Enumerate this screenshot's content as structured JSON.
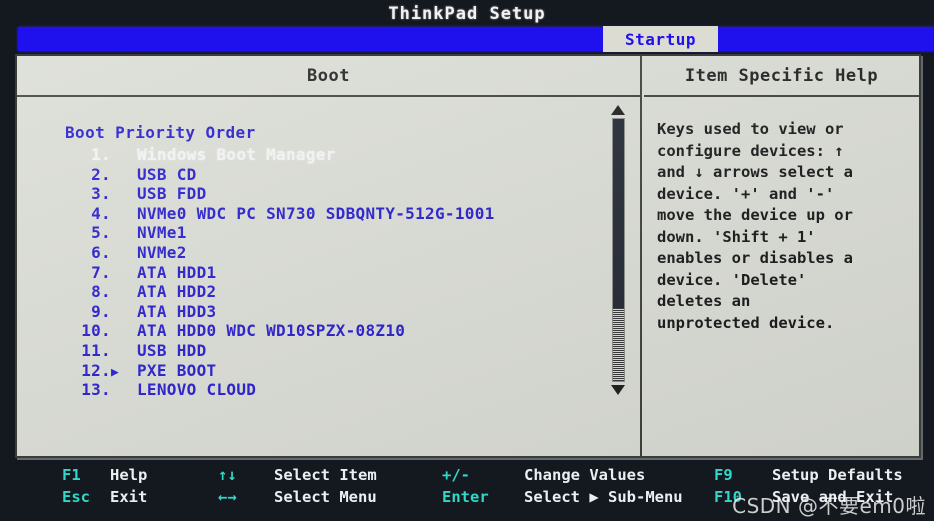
{
  "window": {
    "title": "ThinkPad Setup"
  },
  "menu": {
    "active_tab": "Startup",
    "bar_color": "#1f10ee",
    "tab_text_color": "#1f10ee",
    "tab_bg_color": "#dcdcd2"
  },
  "boot_pane": {
    "title": "Boot",
    "heading": "Boot Priority Order",
    "text_color": "#2217cc",
    "selected_text_color": "#f4f4f4",
    "items": [
      {
        "index": "1.",
        "arrow": "",
        "label": "Windows Boot Manager",
        "selected": true
      },
      {
        "index": "2.",
        "arrow": "",
        "label": "USB CD",
        "selected": false
      },
      {
        "index": "3.",
        "arrow": "",
        "label": "USB FDD",
        "selected": false
      },
      {
        "index": "4.",
        "arrow": "",
        "label": "NVMe0 WDC PC SN730 SDBQNTY-512G-1001",
        "selected": false
      },
      {
        "index": "5.",
        "arrow": "",
        "label": "NVMe1",
        "selected": false
      },
      {
        "index": "6.",
        "arrow": "",
        "label": "NVMe2",
        "selected": false
      },
      {
        "index": "7.",
        "arrow": "",
        "label": "ATA HDD1",
        "selected": false
      },
      {
        "index": "8.",
        "arrow": "",
        "label": "ATA HDD2",
        "selected": false
      },
      {
        "index": "9.",
        "arrow": "",
        "label": "ATA HDD3",
        "selected": false
      },
      {
        "index": "10.",
        "arrow": "",
        "label": "ATA HDD0 WDC WD10SPZX-08Z10",
        "selected": false
      },
      {
        "index": "11.",
        "arrow": "",
        "label": "USB HDD",
        "selected": false
      },
      {
        "index": "12.",
        "arrow": "▶",
        "label": "PXE BOOT",
        "selected": false
      },
      {
        "index": "13.",
        "arrow": "",
        "label": "LENOVO CLOUD",
        "selected": false
      }
    ],
    "scrollbar": {
      "up_arrow": "▲",
      "down_arrow": "▼",
      "thumb_percent": 72
    }
  },
  "help_pane": {
    "title": "Item Specific Help",
    "lines": [
      "Keys used to view or",
      "configure devices: ↑",
      "and ↓ arrows select a",
      "device. '+' and '-'",
      "move the device up or",
      "down. 'Shift + 1'",
      "enables or disables a",
      "device. 'Delete'",
      "deletes an",
      "unprotected device."
    ]
  },
  "function_bar": {
    "key_color": "#2fd8c8",
    "desc_color": "#eceff2",
    "entries": [
      {
        "key": "F1",
        "desc": "Help"
      },
      {
        "key": "↑↓",
        "desc": "Select Item"
      },
      {
        "key": "+/-",
        "desc": "Change Values"
      },
      {
        "key": "F9",
        "desc": "Setup Defaults"
      },
      {
        "key": "Esc",
        "desc": "Exit"
      },
      {
        "key": "←→",
        "desc": "Select Menu"
      },
      {
        "key": "Enter",
        "desc": "Select ▶ Sub-Menu"
      },
      {
        "key": "F10",
        "desc": "Save and Exit"
      }
    ]
  },
  "watermark": {
    "text": "CSDN @不要em0啦"
  }
}
